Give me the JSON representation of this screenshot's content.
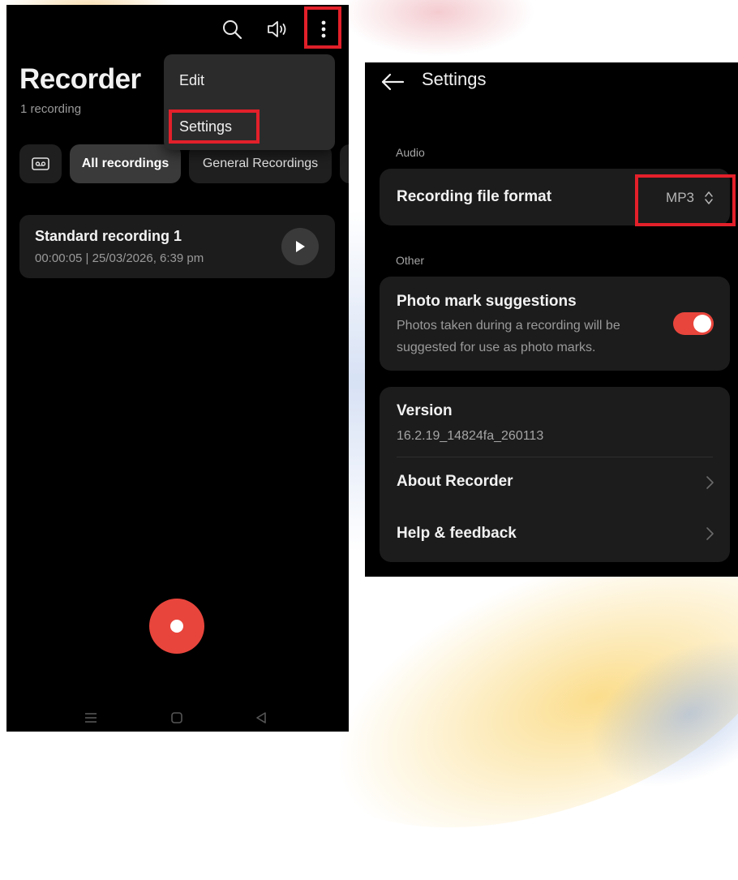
{
  "left_screen": {
    "title": "Recorder",
    "subtitle": "1 recording",
    "toolbar": {
      "search_icon": "search-icon",
      "speaker_icon": "speaker-icon",
      "more_icon": "more-vert-icon"
    },
    "menu": {
      "items": [
        {
          "label": "Edit"
        },
        {
          "label": "Settings"
        }
      ]
    },
    "chips": [
      {
        "label": "",
        "icon": "cassette-icon"
      },
      {
        "label": "All recordings"
      },
      {
        "label": "General Recordings"
      }
    ],
    "recording": {
      "name": "Standard recording 1",
      "meta": "00:00:05 | 25/03/2026, 6:39 pm"
    },
    "accent_color": "#e8453c",
    "highlight_color": "#e3202a"
  },
  "right_screen": {
    "title": "Settings",
    "sections": [
      {
        "label": "Audio",
        "rows": [
          {
            "title": "Recording file format",
            "value": "MP3"
          }
        ]
      },
      {
        "label": "Other",
        "rows": [
          {
            "title": "Photo mark suggestions",
            "description": "Photos taken during a recording will be suggested for use as photo marks.",
            "toggle": true
          }
        ]
      }
    ],
    "about": {
      "version_title": "Version",
      "version_value": "16.2.19_14824fa_260113",
      "about_label": "About Recorder",
      "help_label": "Help & feedback"
    }
  }
}
